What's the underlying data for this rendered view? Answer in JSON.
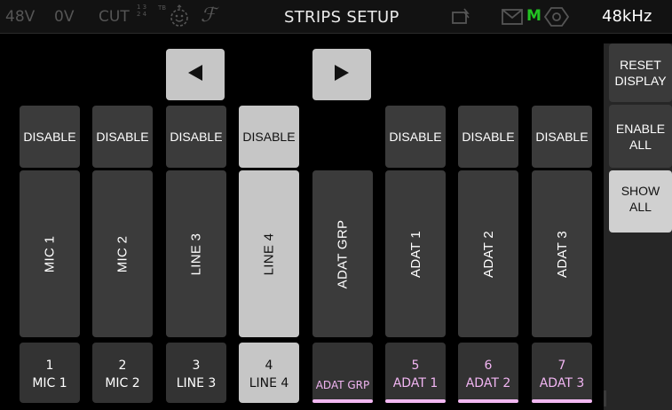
{
  "status": {
    "phantom": "48V",
    "zero_volt": "0V",
    "cut": "CUT",
    "cut_channels_top": "1 3",
    "cut_channels_bottom": "2 4",
    "cut_tb": "TB",
    "title": "STRIPS SETUP",
    "meter_mode": "M",
    "sample_rate": "48kHz",
    "icons": [
      "smiley-icon",
      "f-icon",
      "wifi-icon",
      "mail-icon",
      "gear-icon"
    ]
  },
  "navigation": {
    "prev_icon": "triangle-left-icon",
    "next_icon": "triangle-right-icon"
  },
  "strips": [
    {
      "disable": "DISABLE",
      "name": "MIC 1",
      "number": "1",
      "label": "MIC 1"
    },
    {
      "disable": "DISABLE",
      "name": "MIC 2",
      "number": "2",
      "label": "MIC 2"
    },
    {
      "disable": "DISABLE",
      "name": "LINE 3",
      "number": "3",
      "label": "LINE 3"
    },
    {
      "disable": "DISABLE",
      "name": "LINE 4",
      "number": "4",
      "label": "LINE 4",
      "selected": true
    },
    {
      "disable": "",
      "name": "ADAT GRP",
      "number": "",
      "label": "ADAT GRP"
    },
    {
      "disable": "DISABLE",
      "name": "ADAT 1",
      "number": "5",
      "label": "ADAT 1"
    },
    {
      "disable": "DISABLE",
      "name": "ADAT 2",
      "number": "6",
      "label": "ADAT 2"
    },
    {
      "disable": "DISABLE",
      "name": "ADAT 3",
      "number": "7",
      "label": "ADAT 3"
    }
  ],
  "side_buttons": {
    "reset_line1": "RESET",
    "reset_line2": "DISPLAY",
    "enable_line1": "ENABLE",
    "enable_line2": "ALL",
    "show_line1": "SHOW",
    "show_line2": "ALL"
  },
  "colors": {
    "adat_accent": "#f2b8f2",
    "meter_green": "#22c322",
    "selected": "#c6c6c6"
  }
}
